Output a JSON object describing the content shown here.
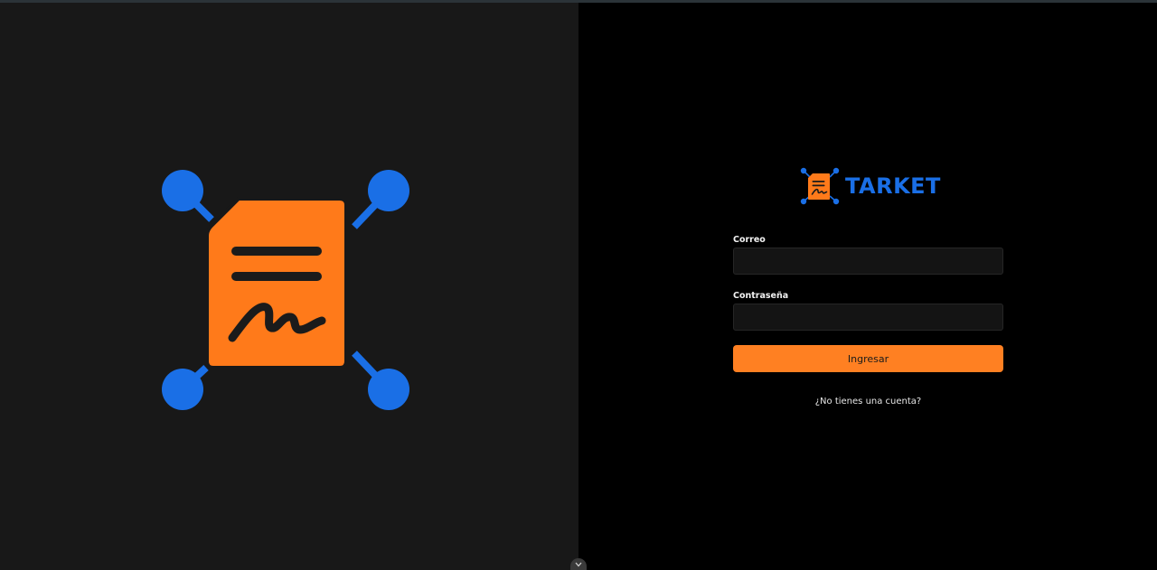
{
  "brand": {
    "name": "TARKET",
    "primary_color": "#1a6fe6",
    "accent_color": "#ff7a1a"
  },
  "hero": {
    "illustration": "signed-document-network-icon"
  },
  "login_form": {
    "email_label": "Correo",
    "email_value": "",
    "password_label": "Contraseña",
    "password_value": "",
    "submit_label": "Ingresar",
    "signup_link": "¿No tienes una cuenta?"
  },
  "controls": {
    "scroll_toggle_icon": "chevron-down-icon"
  }
}
